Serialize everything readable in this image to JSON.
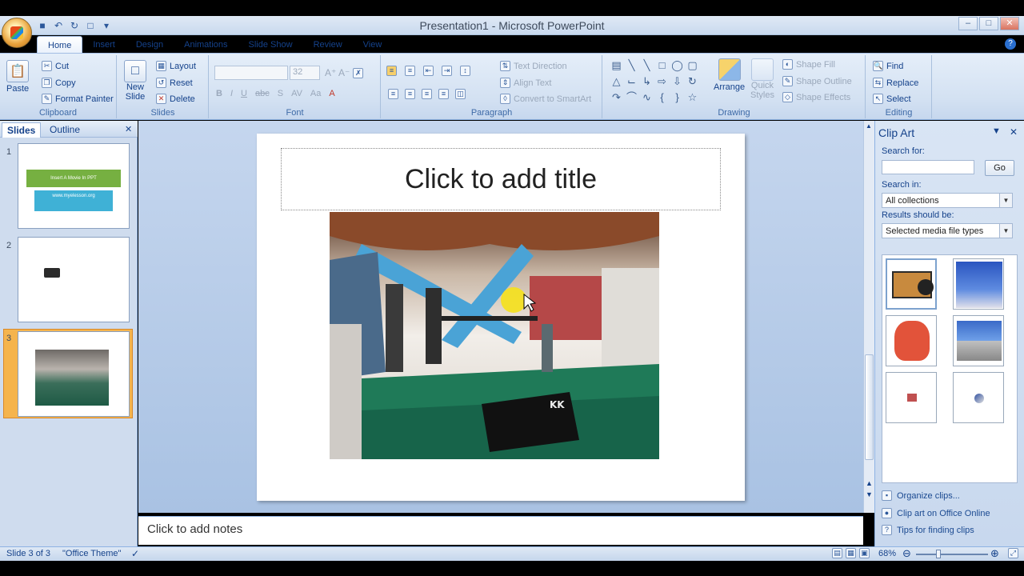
{
  "window": {
    "title": "Presentation1 - Microsoft PowerPoint"
  },
  "tabs": [
    "Home",
    "Insert",
    "Design",
    "Animations",
    "Slide Show",
    "Review",
    "View"
  ],
  "ribbon": {
    "clipboard": {
      "label": "Clipboard",
      "paste": "Paste",
      "cut": "Cut",
      "copy": "Copy",
      "format_painter": "Format Painter"
    },
    "slides": {
      "label": "Slides",
      "new_slide_1": "New",
      "new_slide_2": "Slide",
      "layout": "Layout",
      "reset": "Reset",
      "delete": "Delete"
    },
    "font": {
      "label": "Font",
      "size": "32"
    },
    "paragraph": {
      "label": "Paragraph",
      "text_direction": "Text Direction",
      "align_text": "Align Text",
      "convert": "Convert to SmartArt"
    },
    "drawing": {
      "label": "Drawing",
      "arrange": "Arrange",
      "quick_styles_1": "Quick",
      "quick_styles_2": "Styles",
      "shape_fill": "Shape Fill",
      "shape_outline": "Shape Outline",
      "shape_effects": "Shape Effects"
    },
    "editing": {
      "label": "Editing",
      "find": "Find",
      "replace": "Replace",
      "select": "Select"
    }
  },
  "left_pane": {
    "tab_slides": "Slides",
    "tab_outline": "Outline",
    "slides": [
      {
        "num": "1",
        "line1": "Insert A Movie In PPT",
        "line2": "www.myelesson.org"
      },
      {
        "num": "2"
      },
      {
        "num": "3"
      }
    ]
  },
  "slide": {
    "title_placeholder": "Click to add title"
  },
  "notes": {
    "placeholder": "Click to add notes"
  },
  "clip_art": {
    "title": "Clip Art",
    "search_for_label": "Search for:",
    "search_value": "",
    "go": "Go",
    "search_in_label": "Search in:",
    "search_in_value": "All collections",
    "results_label": "Results should be:",
    "results_value": "Selected media file types",
    "links": [
      "Organize clips...",
      "Clip art on Office Online",
      "Tips for finding clips"
    ]
  },
  "status": {
    "slide": "Slide 3 of 3",
    "theme": "\"Office Theme\"",
    "zoom": "68%"
  },
  "colors": {
    "ribbon": "#d3e1f2",
    "accent": "#15428b",
    "selected_thumb": "#f5b44d"
  }
}
